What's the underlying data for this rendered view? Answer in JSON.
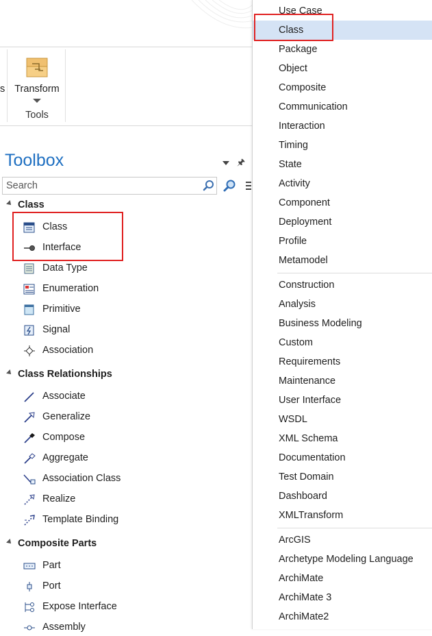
{
  "ribbon": {
    "left_cut_label": "s",
    "transform_label": "Transform",
    "group_label": "Tools"
  },
  "toolbox": {
    "title": "Toolbox",
    "search_placeholder": "Search",
    "categories": [
      {
        "name": "Class",
        "items": [
          "Class",
          "Interface",
          "Data Type",
          "Enumeration",
          "Primitive",
          "Signal",
          "Association"
        ]
      },
      {
        "name": "Class Relationships",
        "items": [
          "Associate",
          "Generalize",
          "Compose",
          "Aggregate",
          "Association Class",
          "Realize",
          "Template Binding"
        ]
      },
      {
        "name": "Composite Parts",
        "items": [
          "Part",
          "Port",
          "Expose Interface",
          "Assembly"
        ]
      }
    ]
  },
  "menu": {
    "group1": [
      "Use Case",
      "Class",
      "Package",
      "Object",
      "Composite",
      "Communication",
      "Interaction",
      "Timing",
      "State",
      "Activity",
      "Component",
      "Deployment",
      "Profile",
      "Metamodel"
    ],
    "group2": [
      "Construction",
      "Analysis",
      "Business Modeling",
      "Custom",
      "Requirements",
      "Maintenance",
      "User Interface",
      "WSDL",
      "XML Schema",
      "Documentation",
      "Test Domain",
      "Dashboard",
      "XMLTransform"
    ],
    "group3": [
      "ArcGIS",
      "Archetype Modeling Language",
      "ArchiMate",
      "ArchiMate 3",
      "ArchiMate2"
    ],
    "selected": "Class"
  },
  "colors": {
    "title_blue": "#1e6fc1",
    "highlight_red": "#e02020",
    "menu_selected": "#d5e3f5"
  }
}
